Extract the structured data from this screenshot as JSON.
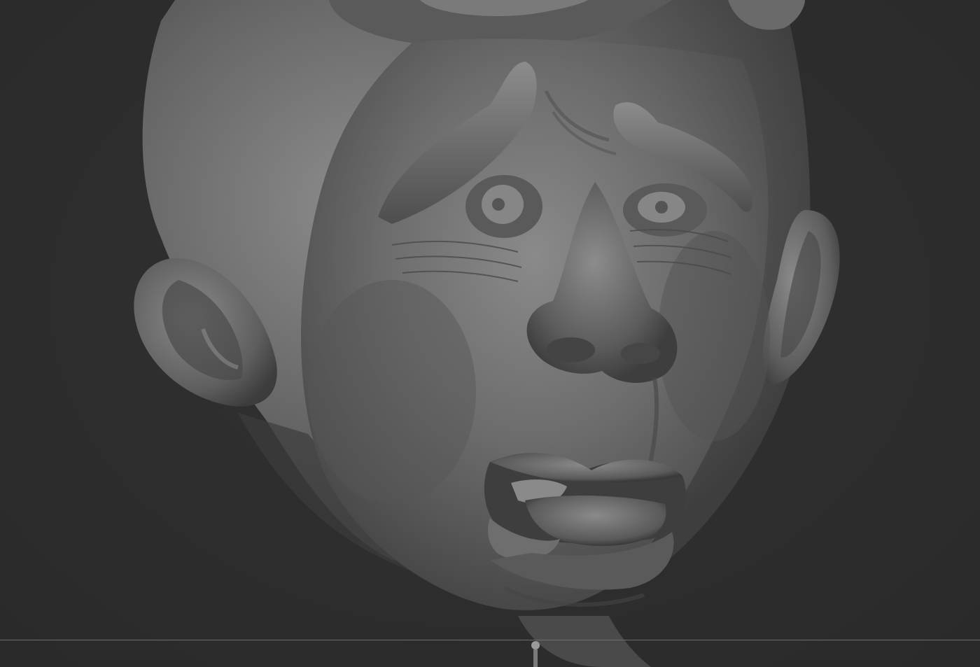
{
  "viewport": {
    "background_color": "#2e2e2e",
    "model_base_color": "#6e6e6e",
    "model_highlight_color": "#9a9a9a",
    "model_shadow_color": "#3a3a3a",
    "floor_line_color": "#6e6e6e"
  }
}
